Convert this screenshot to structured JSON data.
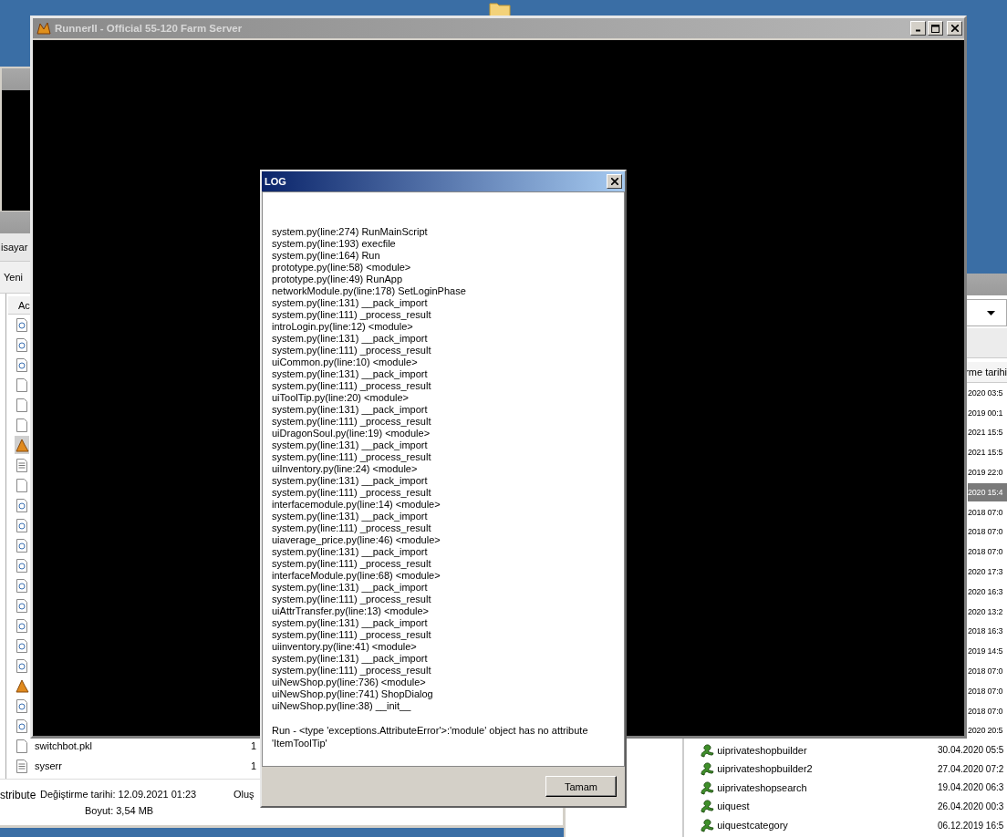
{
  "left_explorer": {
    "toolbar_1": "isayar",
    "toolbar_2": "Yeni",
    "column_1": "Ac",
    "rows": [
      {
        "kind": "python",
        "selected": false
      },
      {
        "kind": "python",
        "selected": false
      },
      {
        "kind": "python",
        "selected": false
      },
      {
        "kind": "blank",
        "selected": false
      },
      {
        "kind": "blank",
        "selected": false
      },
      {
        "kind": "blank",
        "selected": false
      },
      {
        "kind": "app",
        "selected": true
      },
      {
        "kind": "text",
        "selected": false
      },
      {
        "kind": "blank",
        "selected": false
      },
      {
        "kind": "python",
        "selected": false
      },
      {
        "kind": "python",
        "selected": false
      },
      {
        "kind": "python",
        "selected": false
      },
      {
        "kind": "python",
        "selected": false
      },
      {
        "kind": "python",
        "selected": false
      },
      {
        "kind": "python",
        "selected": false
      },
      {
        "kind": "python",
        "selected": false
      },
      {
        "kind": "python",
        "selected": false
      },
      {
        "kind": "python",
        "selected": false
      },
      {
        "kind": "app",
        "selected": false
      },
      {
        "kind": "python",
        "selected": false
      },
      {
        "kind": "python",
        "selected": false
      },
      {
        "kind": "blank",
        "selected": false,
        "name": "switchbot.pkl",
        "column_2": "1"
      },
      {
        "kind": "text",
        "selected": false,
        "name": "syserr",
        "column_2": "1"
      }
    ],
    "status_bar": {
      "type": "stribute",
      "modified": "Değiştirme tarihi: 12.09.2021 01:23",
      "created": "Oluş",
      "size": "Boyut: 3,54 MB"
    }
  },
  "right_explorer": {
    "column_header": "rme tarihi",
    "covered_rows": [
      {
        "date": "2020 03:5",
        "selected": false
      },
      {
        "date": "2019 00:1",
        "selected": false
      },
      {
        "date": "2021 15:5",
        "selected": false
      },
      {
        "date": "2021 15:5",
        "selected": false
      },
      {
        "date": "2019 22:0",
        "selected": false
      },
      {
        "date": "2020 15:4",
        "selected": true
      },
      {
        "date": "2018 07:0",
        "selected": false
      },
      {
        "date": "2018 07:0",
        "selected": false
      },
      {
        "date": "2018 07:0",
        "selected": false
      },
      {
        "date": "2020 17:3",
        "selected": false
      },
      {
        "date": "2020 16:3",
        "selected": false
      },
      {
        "date": "2020 13:2",
        "selected": false
      },
      {
        "date": "2018 16:3",
        "selected": false
      },
      {
        "date": "2019 14:5",
        "selected": false
      },
      {
        "date": "2018 07:0",
        "selected": false
      },
      {
        "date": "2018 07:0",
        "selected": false
      },
      {
        "date": "2018 07:0",
        "selected": false
      },
      {
        "date": "2020 20:5",
        "selected": false
      }
    ],
    "rows": [
      {
        "name": "uiprivateshopbuilder",
        "date": "30.04.2020 05:5",
        "selected": false
      },
      {
        "name": "uiprivateshopbuilder2",
        "date": "27.04.2020 07:2",
        "selected": false
      },
      {
        "name": "uiprivateshopsearch",
        "date": "19.04.2020 06:3",
        "selected": false
      },
      {
        "name": "uiquest",
        "date": "26.04.2020 00:3",
        "selected": false
      },
      {
        "name": "uiquestcategory",
        "date": "06.12.2019 16:5",
        "selected": false
      }
    ]
  },
  "main_window": {
    "title": "RunnerII - Official 55-120 Farm Server"
  },
  "log_dialog": {
    "title": "LOG",
    "lines": [
      "system.py(line:274) RunMainScript",
      "system.py(line:193) execfile",
      "system.py(line:164) Run",
      "prototype.py(line:58) <module>",
      "prototype.py(line:49) RunApp",
      "networkModule.py(line:178) SetLoginPhase",
      "system.py(line:131) __pack_import",
      "system.py(line:111) _process_result",
      "introLogin.py(line:12) <module>",
      "system.py(line:131) __pack_import",
      "system.py(line:111) _process_result",
      "uiCommon.py(line:10) <module>",
      "system.py(line:131) __pack_import",
      "system.py(line:111) _process_result",
      "uiToolTip.py(line:20) <module>",
      "system.py(line:131) __pack_import",
      "system.py(line:111) _process_result",
      "uiDragonSoul.py(line:19) <module>",
      "system.py(line:131) __pack_import",
      "system.py(line:111) _process_result",
      "uiInventory.py(line:24) <module>",
      "system.py(line:131) __pack_import",
      "system.py(line:111) _process_result",
      "interfacemodule.py(line:14) <module>",
      "system.py(line:131) __pack_import",
      "system.py(line:111) _process_result",
      "uiaverage_price.py(line:46) <module>",
      "system.py(line:131) __pack_import",
      "system.py(line:111) _process_result",
      "interfaceModule.py(line:68) <module>",
      "system.py(line:131) __pack_import",
      "system.py(line:111) _process_result",
      "uiAttrTransfer.py(line:13) <module>",
      "system.py(line:131) __pack_import",
      "system.py(line:111) _process_result",
      "uiinventory.py(line:41) <module>",
      "system.py(line:131) __pack_import",
      "system.py(line:111) _process_result",
      "uiNewShop.py(line:736) <module>",
      "uiNewShop.py(line:741) ShopDialog",
      "uiNewShop.py(line:38) __init__"
    ],
    "error": "Run - <type 'exceptions.AttributeError'>:'module' object has no attribute 'ItemToolTip'",
    "button": "Tamam"
  }
}
